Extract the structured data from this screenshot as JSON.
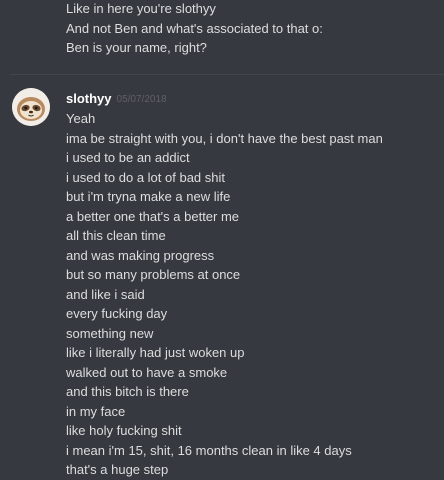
{
  "previous_messages": [
    "Like in here you're slothyy",
    "And not Ben and what's associated to that o:",
    "Ben is your name, right?"
  ],
  "message": {
    "username": "slothyy",
    "timestamp": "05/07/2018",
    "avatar_icon": "sloth-avatar-icon",
    "lines": [
      "Yeah",
      "ima be straight with you, i don't have the best past man",
      "i used to be an addict",
      "i used to do a lot of bad shit",
      "but i'm tryna make a new life",
      "a better one that's a better me",
      "all this clean time",
      "and was making progress",
      "but so many problems at once",
      "and like i said",
      "every fucking day",
      "something new",
      "like i literally had just woken up",
      "walked out to have a smoke",
      "and this bitch is there",
      "in my face",
      "like holy fucking shit",
      "i mean i'm 15, shit, 16 months clean in like 4 days",
      "that's a huge step"
    ]
  },
  "colors": {
    "background": "#36393f",
    "text": "#dcddde",
    "username": "#ffffff",
    "timestamp": "#5f6166",
    "divider": "#42454a"
  }
}
